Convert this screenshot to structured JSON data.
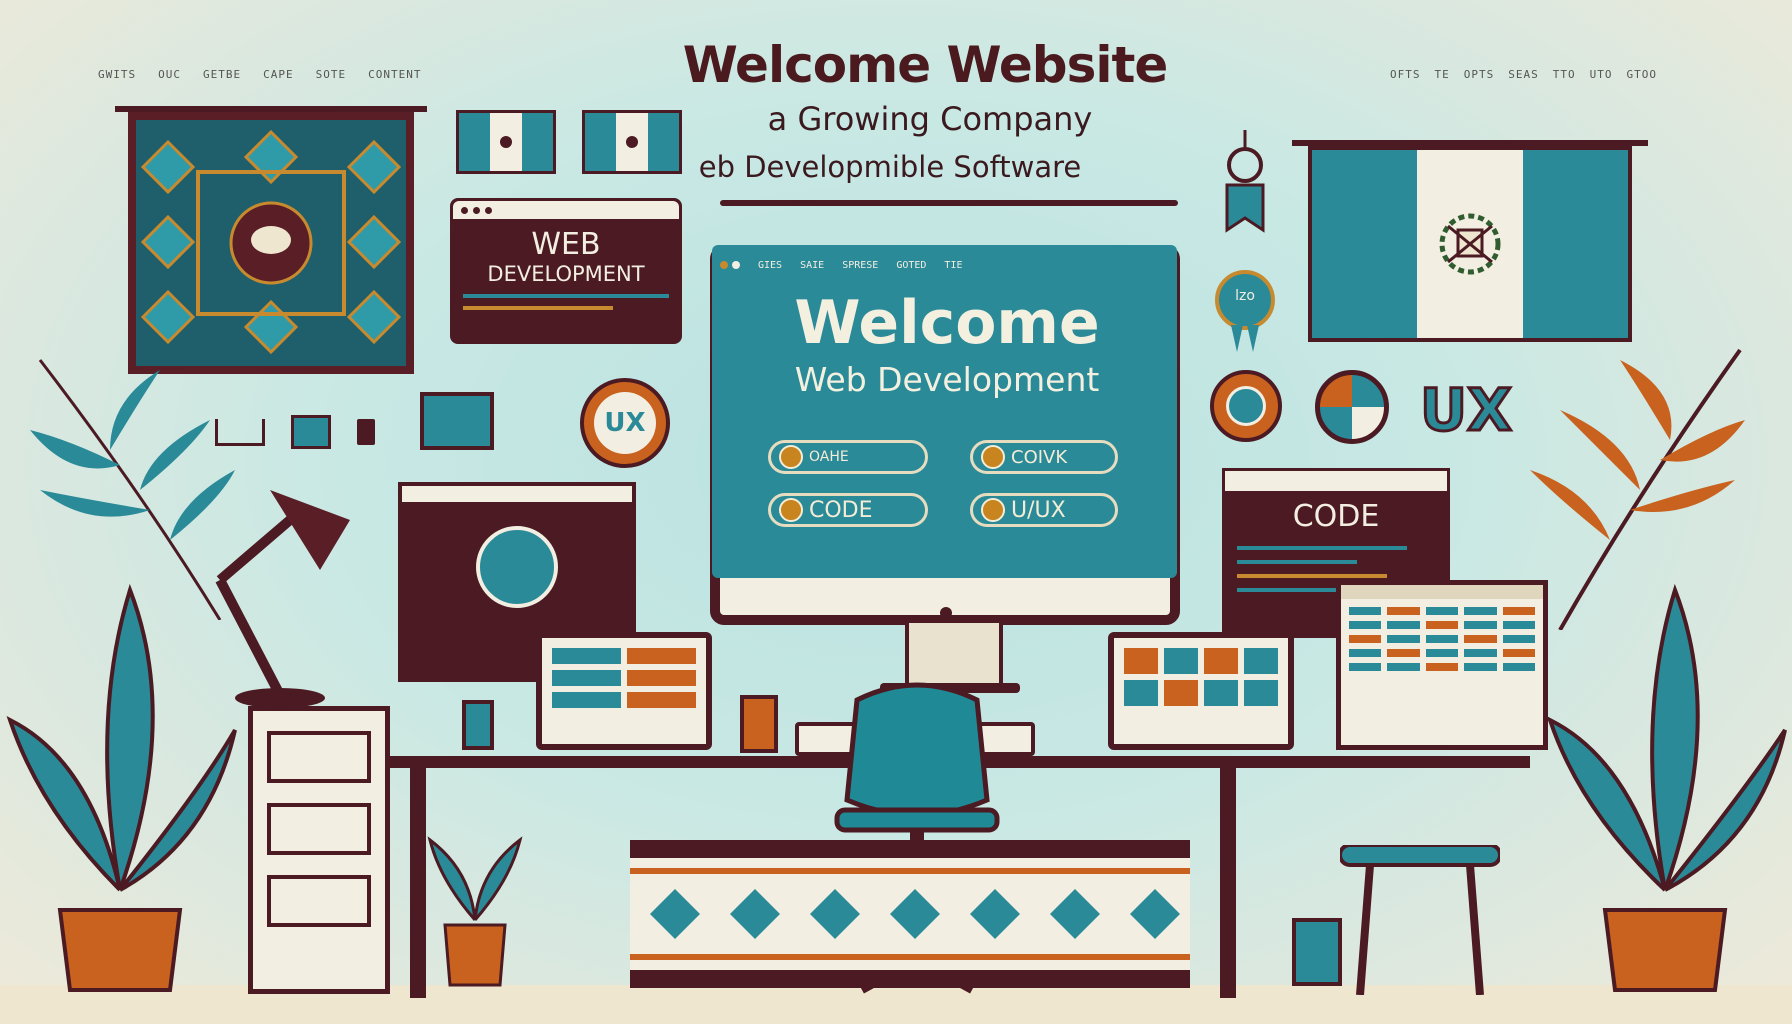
{
  "header": {
    "title": "Welcome Website",
    "subtitle_line1": "a Growing Company",
    "subtitle_line2": "eb Developmible Software"
  },
  "nav_left": [
    "GWITS",
    "OUC",
    "GETBE",
    "CAPE",
    "SOTE",
    "CONTENT"
  ],
  "nav_right": [
    "OFTS",
    "TE",
    "OPTS",
    "SEAS",
    "TTO",
    "UTO",
    "GTOO"
  ],
  "monitor": {
    "tabs": [
      "GIES",
      "SAIE",
      "SPRESE",
      "GOTED",
      "TIE"
    ],
    "welcome": "Welcome",
    "subtitle": "Web Development",
    "buttons": [
      "OAHE",
      "COIVK",
      "CODE",
      "U/UX"
    ]
  },
  "panels": {
    "web_development_line1": "WEB",
    "web_development_line2": "DEVELOPMENT",
    "code": "CODE",
    "ux_label": "UX",
    "ux_badge": "UX",
    "badge_text": "lzo"
  },
  "colors": {
    "teal": "#2a8a98",
    "maroon": "#4b1a22",
    "cream": "#f3eee2",
    "orange": "#c8621e",
    "background": "#c9e8e4"
  }
}
